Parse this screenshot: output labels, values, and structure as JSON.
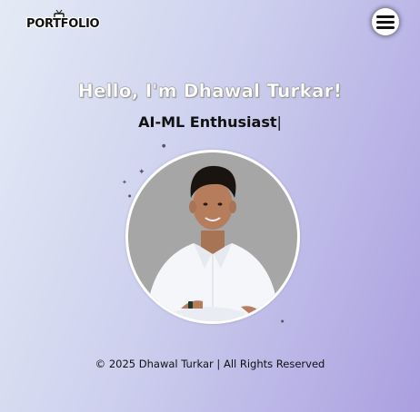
{
  "header": {
    "logo_text": "PORTFOLIO",
    "logo_icon": "tv-icon",
    "menu_icon": "hamburger-menu-icon"
  },
  "hero": {
    "greeting": "Hello, I'm Dhawal Turkar!",
    "role": "AI-ML Enthusiast",
    "cursor": "|",
    "photo_icon": "profile-photo"
  },
  "footer": {
    "copyright": "© 2025 Dhawal Turkar | All Rights Reserved"
  },
  "colors": {
    "background_start": "#e4ebf5",
    "background_end": "#ab9fe0",
    "photo_background": "#a6a6a6",
    "text": "#111111"
  }
}
